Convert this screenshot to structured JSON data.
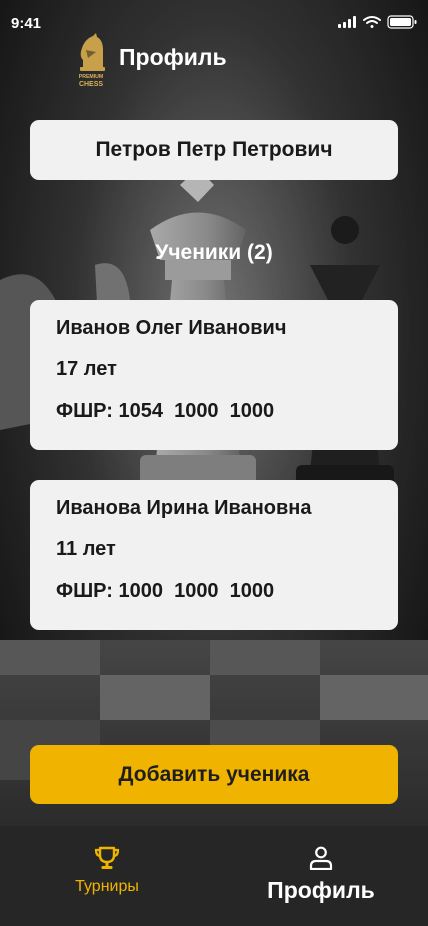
{
  "status_bar": {
    "time": "9:41"
  },
  "header": {
    "title": "Профиль",
    "logo_text_top": "PREMIUM",
    "logo_text_bottom": "CHESS"
  },
  "profile": {
    "full_name": "Петров Петр Петрович"
  },
  "students_section": {
    "title": "Ученики (2)"
  },
  "students": [
    {
      "name": "Иванов Олег Иванович",
      "age": "17 лет",
      "ratings": "ФШР: 1054  1000  1000"
    },
    {
      "name": "Иванова Ирина Ивановна",
      "age": "11 лет",
      "ratings": "ФШР: 1000  1000  1000"
    }
  ],
  "actions": {
    "add_student_label": "Добавить ученика"
  },
  "tabbar": {
    "tournaments_label": "Турниры",
    "profile_label": "Профиль",
    "active_tab": "profile"
  },
  "colors": {
    "accent": "#f0b400",
    "card_bg": "#f1f1f1",
    "tabbar_bg": "#262626",
    "text_dark": "#1a1a1a"
  },
  "icons": {
    "logo": "chess-knight-logo-icon",
    "tournaments": "trophy-icon",
    "profile": "user-icon"
  }
}
